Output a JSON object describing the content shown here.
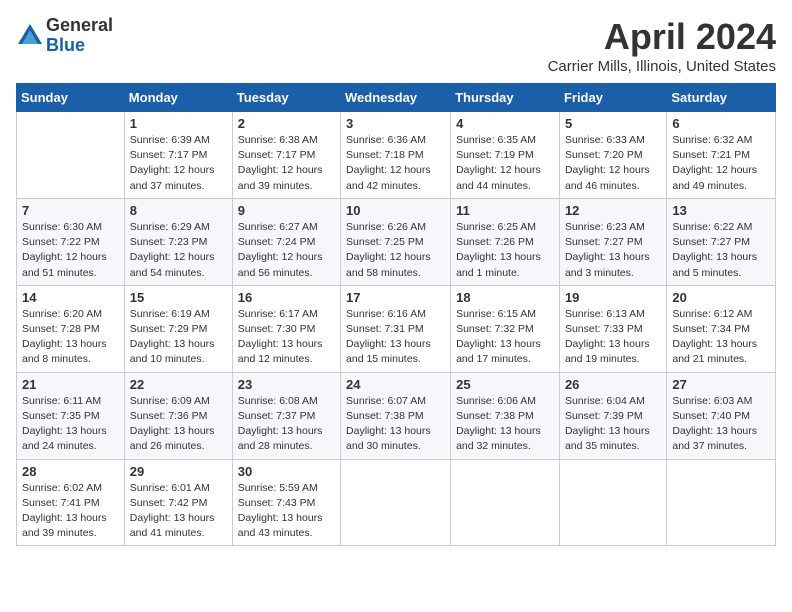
{
  "logo": {
    "general": "General",
    "blue": "Blue"
  },
  "title": "April 2024",
  "location": "Carrier Mills, Illinois, United States",
  "days_of_week": [
    "Sunday",
    "Monday",
    "Tuesday",
    "Wednesday",
    "Thursday",
    "Friday",
    "Saturday"
  ],
  "weeks": [
    [
      {
        "day": "",
        "sunrise": "",
        "sunset": "",
        "daylight": ""
      },
      {
        "day": "1",
        "sunrise": "Sunrise: 6:39 AM",
        "sunset": "Sunset: 7:17 PM",
        "daylight": "Daylight: 12 hours and 37 minutes."
      },
      {
        "day": "2",
        "sunrise": "Sunrise: 6:38 AM",
        "sunset": "Sunset: 7:17 PM",
        "daylight": "Daylight: 12 hours and 39 minutes."
      },
      {
        "day": "3",
        "sunrise": "Sunrise: 6:36 AM",
        "sunset": "Sunset: 7:18 PM",
        "daylight": "Daylight: 12 hours and 42 minutes."
      },
      {
        "day": "4",
        "sunrise": "Sunrise: 6:35 AM",
        "sunset": "Sunset: 7:19 PM",
        "daylight": "Daylight: 12 hours and 44 minutes."
      },
      {
        "day": "5",
        "sunrise": "Sunrise: 6:33 AM",
        "sunset": "Sunset: 7:20 PM",
        "daylight": "Daylight: 12 hours and 46 minutes."
      },
      {
        "day": "6",
        "sunrise": "Sunrise: 6:32 AM",
        "sunset": "Sunset: 7:21 PM",
        "daylight": "Daylight: 12 hours and 49 minutes."
      }
    ],
    [
      {
        "day": "7",
        "sunrise": "Sunrise: 6:30 AM",
        "sunset": "Sunset: 7:22 PM",
        "daylight": "Daylight: 12 hours and 51 minutes."
      },
      {
        "day": "8",
        "sunrise": "Sunrise: 6:29 AM",
        "sunset": "Sunset: 7:23 PM",
        "daylight": "Daylight: 12 hours and 54 minutes."
      },
      {
        "day": "9",
        "sunrise": "Sunrise: 6:27 AM",
        "sunset": "Sunset: 7:24 PM",
        "daylight": "Daylight: 12 hours and 56 minutes."
      },
      {
        "day": "10",
        "sunrise": "Sunrise: 6:26 AM",
        "sunset": "Sunset: 7:25 PM",
        "daylight": "Daylight: 12 hours and 58 minutes."
      },
      {
        "day": "11",
        "sunrise": "Sunrise: 6:25 AM",
        "sunset": "Sunset: 7:26 PM",
        "daylight": "Daylight: 13 hours and 1 minute."
      },
      {
        "day": "12",
        "sunrise": "Sunrise: 6:23 AM",
        "sunset": "Sunset: 7:27 PM",
        "daylight": "Daylight: 13 hours and 3 minutes."
      },
      {
        "day": "13",
        "sunrise": "Sunrise: 6:22 AM",
        "sunset": "Sunset: 7:27 PM",
        "daylight": "Daylight: 13 hours and 5 minutes."
      }
    ],
    [
      {
        "day": "14",
        "sunrise": "Sunrise: 6:20 AM",
        "sunset": "Sunset: 7:28 PM",
        "daylight": "Daylight: 13 hours and 8 minutes."
      },
      {
        "day": "15",
        "sunrise": "Sunrise: 6:19 AM",
        "sunset": "Sunset: 7:29 PM",
        "daylight": "Daylight: 13 hours and 10 minutes."
      },
      {
        "day": "16",
        "sunrise": "Sunrise: 6:17 AM",
        "sunset": "Sunset: 7:30 PM",
        "daylight": "Daylight: 13 hours and 12 minutes."
      },
      {
        "day": "17",
        "sunrise": "Sunrise: 6:16 AM",
        "sunset": "Sunset: 7:31 PM",
        "daylight": "Daylight: 13 hours and 15 minutes."
      },
      {
        "day": "18",
        "sunrise": "Sunrise: 6:15 AM",
        "sunset": "Sunset: 7:32 PM",
        "daylight": "Daylight: 13 hours and 17 minutes."
      },
      {
        "day": "19",
        "sunrise": "Sunrise: 6:13 AM",
        "sunset": "Sunset: 7:33 PM",
        "daylight": "Daylight: 13 hours and 19 minutes."
      },
      {
        "day": "20",
        "sunrise": "Sunrise: 6:12 AM",
        "sunset": "Sunset: 7:34 PM",
        "daylight": "Daylight: 13 hours and 21 minutes."
      }
    ],
    [
      {
        "day": "21",
        "sunrise": "Sunrise: 6:11 AM",
        "sunset": "Sunset: 7:35 PM",
        "daylight": "Daylight: 13 hours and 24 minutes."
      },
      {
        "day": "22",
        "sunrise": "Sunrise: 6:09 AM",
        "sunset": "Sunset: 7:36 PM",
        "daylight": "Daylight: 13 hours and 26 minutes."
      },
      {
        "day": "23",
        "sunrise": "Sunrise: 6:08 AM",
        "sunset": "Sunset: 7:37 PM",
        "daylight": "Daylight: 13 hours and 28 minutes."
      },
      {
        "day": "24",
        "sunrise": "Sunrise: 6:07 AM",
        "sunset": "Sunset: 7:38 PM",
        "daylight": "Daylight: 13 hours and 30 minutes."
      },
      {
        "day": "25",
        "sunrise": "Sunrise: 6:06 AM",
        "sunset": "Sunset: 7:38 PM",
        "daylight": "Daylight: 13 hours and 32 minutes."
      },
      {
        "day": "26",
        "sunrise": "Sunrise: 6:04 AM",
        "sunset": "Sunset: 7:39 PM",
        "daylight": "Daylight: 13 hours and 35 minutes."
      },
      {
        "day": "27",
        "sunrise": "Sunrise: 6:03 AM",
        "sunset": "Sunset: 7:40 PM",
        "daylight": "Daylight: 13 hours and 37 minutes."
      }
    ],
    [
      {
        "day": "28",
        "sunrise": "Sunrise: 6:02 AM",
        "sunset": "Sunset: 7:41 PM",
        "daylight": "Daylight: 13 hours and 39 minutes."
      },
      {
        "day": "29",
        "sunrise": "Sunrise: 6:01 AM",
        "sunset": "Sunset: 7:42 PM",
        "daylight": "Daylight: 13 hours and 41 minutes."
      },
      {
        "day": "30",
        "sunrise": "Sunrise: 5:59 AM",
        "sunset": "Sunset: 7:43 PM",
        "daylight": "Daylight: 13 hours and 43 minutes."
      },
      {
        "day": "",
        "sunrise": "",
        "sunset": "",
        "daylight": ""
      },
      {
        "day": "",
        "sunrise": "",
        "sunset": "",
        "daylight": ""
      },
      {
        "day": "",
        "sunrise": "",
        "sunset": "",
        "daylight": ""
      },
      {
        "day": "",
        "sunrise": "",
        "sunset": "",
        "daylight": ""
      }
    ]
  ]
}
